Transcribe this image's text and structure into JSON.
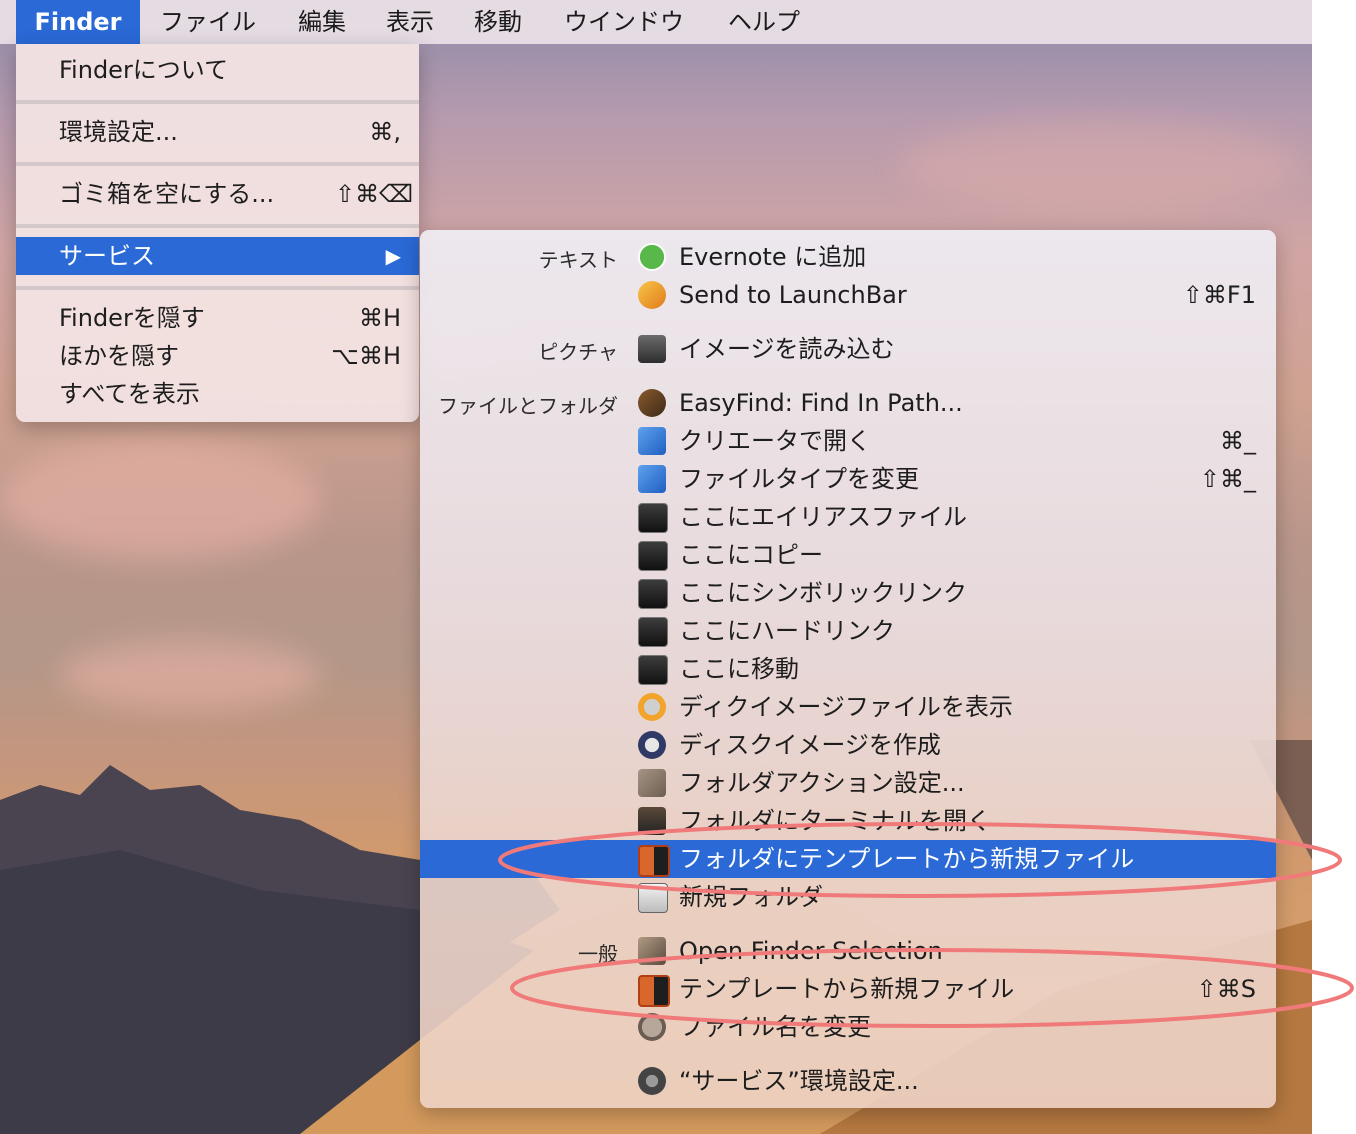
{
  "menubar": {
    "app": "Finder",
    "items": [
      "ファイル",
      "編集",
      "表示",
      "移動",
      "ウインドウ",
      "ヘルプ"
    ]
  },
  "finder_menu": {
    "about": "Finderについて",
    "prefs": {
      "label": "環境設定...",
      "shortcut": "⌘,"
    },
    "empty_trash": {
      "label": "ゴミ箱を空にする...",
      "shortcut": "⇧⌘⌫"
    },
    "services": {
      "label": "サービス",
      "arrow": "▶"
    },
    "hide_finder": {
      "label": "Finderを隠す",
      "shortcut": "⌘H"
    },
    "hide_others": {
      "label": "ほかを隠す",
      "shortcut": "⌥⌘H"
    },
    "show_all": {
      "label": "すべてを表示"
    }
  },
  "services_menu": {
    "categories": {
      "text": "テキスト",
      "picture": "ピクチャ",
      "files": "ファイルとフォルダ",
      "general": "一般"
    },
    "items": [
      {
        "label": "Evernote に追加",
        "shortcut": "",
        "icon": "evernote-icon"
      },
      {
        "label": "Send to LaunchBar",
        "shortcut": "⇧⌘F1",
        "icon": "launchbar-icon"
      },
      {
        "label": "イメージを読み込む",
        "shortcut": "",
        "icon": "image-capture-icon"
      },
      {
        "label": "EasyFind: Find In Path...",
        "shortcut": "",
        "icon": "easyfind-icon"
      },
      {
        "label": "クリエータで開く",
        "shortcut": "⌘_",
        "icon": "app-store-icon"
      },
      {
        "label": "ファイルタイプを変更",
        "shortcut": "⇧⌘_",
        "icon": "app-store-icon"
      },
      {
        "label": "ここにエイリアスファイル",
        "shortcut": "",
        "icon": "alias-icon"
      },
      {
        "label": "ここにコピー",
        "shortcut": "",
        "icon": "copy-icon"
      },
      {
        "label": "ここにシンボリックリンク",
        "shortcut": "",
        "icon": "symlink-icon"
      },
      {
        "label": "ここにハードリンク",
        "shortcut": "",
        "icon": "hardlink-icon"
      },
      {
        "label": "ここに移動",
        "shortcut": "",
        "icon": "move-icon"
      },
      {
        "label": "ディクイメージファイルを表示",
        "shortcut": "",
        "icon": "disk-image-icon"
      },
      {
        "label": "ディスクイメージを作成",
        "shortcut": "",
        "icon": "disk-utility-icon"
      },
      {
        "label": "フォルダアクション設定...",
        "shortcut": "",
        "icon": "folder-action-icon"
      },
      {
        "label": "フォルダにターミナルを開く",
        "shortcut": "",
        "icon": "terminal-icon"
      },
      {
        "label": "フォルダにテンプレートから新規ファイル",
        "shortcut": "",
        "icon": "template-icon"
      },
      {
        "label": "新規フォルダ",
        "shortcut": "",
        "icon": "workflow-icon"
      },
      {
        "label": "Open Finder Selection",
        "shortcut": "",
        "icon": "finder-selection-icon"
      },
      {
        "label": "テンプレートから新規ファイル",
        "shortcut": "⇧⌘S",
        "icon": "template-icon"
      },
      {
        "label": "ファイル名を変更",
        "shortcut": "",
        "icon": "rename-icon"
      },
      {
        "label": "“サービス”環境設定...",
        "shortcut": "",
        "icon": "gear-icon"
      }
    ]
  },
  "colors": {
    "selection": "#2a69d6",
    "annotation": "#f07a7a"
  }
}
